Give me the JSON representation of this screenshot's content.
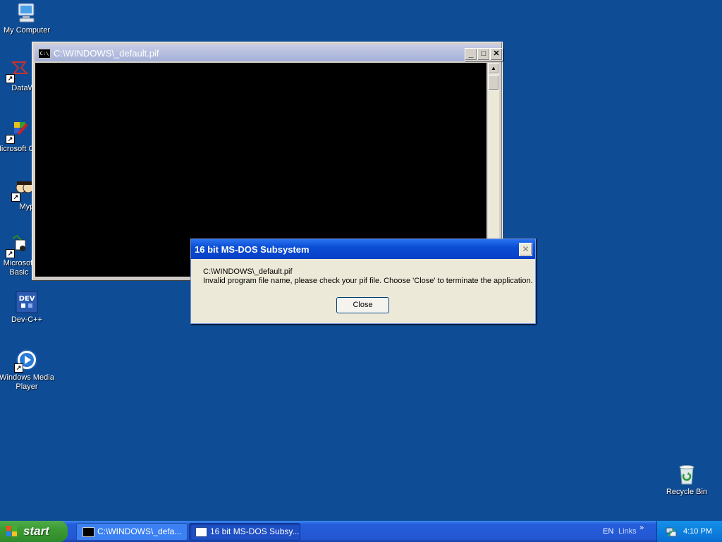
{
  "desktop": {
    "icons": [
      {
        "label": "My Computer"
      },
      {
        "label": "DataWa"
      },
      {
        "label": "Microsoft C++"
      },
      {
        "label": "Myp"
      },
      {
        "label": "Microsoft Basic"
      },
      {
        "label": "Dev-C++"
      },
      {
        "label": "Windows Media Player"
      },
      {
        "label": "Recycle Bin"
      }
    ]
  },
  "console_window": {
    "title": "C:\\WINDOWS\\_default.pif",
    "icon_text": "C:\\",
    "minimize": "_",
    "maximize": "□",
    "close": "✕"
  },
  "dialog": {
    "title": "16 bit MS-DOS Subsystem",
    "close": "✕",
    "line1": "C:\\WINDOWS\\_default.pif",
    "line2": "Invalid program file name, please check your pif file. Choose 'Close' to terminate the application.",
    "button": "Close"
  },
  "taskbar": {
    "start_label": "start",
    "tasks": [
      {
        "label": "C:\\WINDOWS\\_defa..."
      },
      {
        "label": "16 bit MS-DOS Subsy..."
      }
    ],
    "language": "EN",
    "links": "Links",
    "links_chevron": "»",
    "clock": "4:10 PM"
  },
  "colors": {
    "desktop": "#0f4c96",
    "dialog_title": "#0a4ed4",
    "start_green": "#3c9b33"
  },
  "icons": [
    "my-computer-icon",
    "datawarehouse-icon",
    "visual-cpp-icon",
    "myp-icon",
    "visual-basic-icon",
    "dev-cpp-icon",
    "media-player-icon",
    "recycle-bin-icon",
    "cmd-icon",
    "windows-flag-icon",
    "network-icon"
  ]
}
